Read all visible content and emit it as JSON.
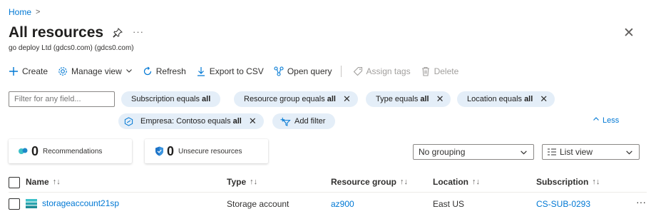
{
  "breadcrumb": {
    "home": "Home",
    "separator": ">"
  },
  "header": {
    "title": "All resources",
    "subtitle": "go deploy Ltd (gdcs0.com) (gdcs0.com)",
    "more": "···",
    "close": "✕"
  },
  "toolbar": {
    "create": "Create",
    "manage_view": "Manage view",
    "refresh": "Refresh",
    "export_csv": "Export to CSV",
    "open_query": "Open query",
    "assign_tags": "Assign tags",
    "delete": "Delete"
  },
  "filters": {
    "placeholder": "Filter for any field...",
    "pills": [
      {
        "label": "Subscription equals",
        "value": "all",
        "removable": false
      },
      {
        "label": "Resource group equals",
        "value": "all",
        "removable": true
      },
      {
        "label": "Type equals",
        "value": "all",
        "removable": true
      },
      {
        "label": "Location equals",
        "value": "all",
        "removable": true
      },
      {
        "label": "Empresa: Contoso equals",
        "value": "all",
        "removable": true
      }
    ],
    "add_filter": "Add filter",
    "less": "Less"
  },
  "summary": {
    "recommendations": {
      "count": "0",
      "label": "Recommendations"
    },
    "unsecure": {
      "count": "0",
      "label": "Unsecure resources"
    }
  },
  "view_controls": {
    "grouping": "No grouping",
    "view": "List view"
  },
  "table": {
    "columns": [
      "Name",
      "Type",
      "Resource group",
      "Location",
      "Subscription"
    ],
    "sort_glyph": "↑↓",
    "rows": [
      {
        "name": "storageaccount21sp",
        "type": "Storage account",
        "resource_group": "az900",
        "location": "East US",
        "subscription": "CS-SUB-0293"
      }
    ],
    "row_more": "···"
  },
  "colors": {
    "accent": "#0078d4",
    "pill_bg": "#e4eef8",
    "storage_teal": "#3cc0c8"
  }
}
